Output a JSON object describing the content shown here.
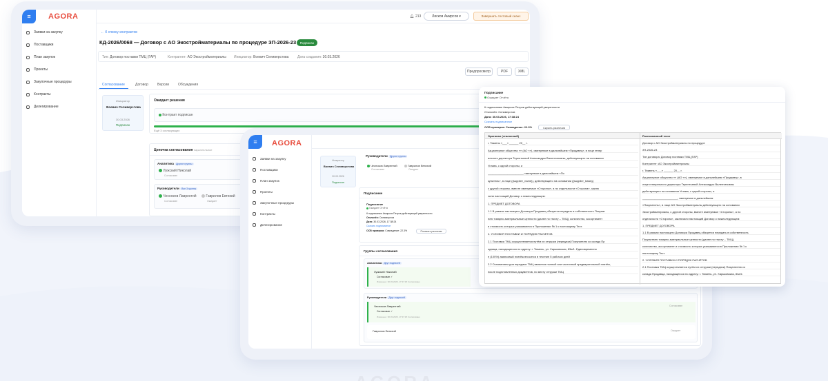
{
  "brand": "AGORA",
  "nav": [
    {
      "icon": "user-icon",
      "label": "Заявки на закупку"
    },
    {
      "icon": "building-icon",
      "label": "Поставщики"
    },
    {
      "icon": "calendar-icon",
      "label": "План закупок"
    },
    {
      "icon": "folder-icon",
      "label": "Проекты"
    },
    {
      "icon": "list-icon",
      "label": "Закупочные процедуры"
    },
    {
      "icon": "document-icon",
      "label": "Контракты"
    },
    {
      "icon": "stack-icon",
      "label": "Делегирование"
    }
  ],
  "header": {
    "counter": "213",
    "user": "Лисков Амирсов",
    "action": "Завершить тестовый сеанс"
  },
  "contract": {
    "back": "← К списку контрактов",
    "title": "КД-2026/0068 — Договор с АО Экостройматериалы по процедуре ЗП-2026-23",
    "status": "Подписан",
    "meta": [
      {
        "k": "Тип:",
        "v": "Договор поставки ТМЦ (ГАР)"
      },
      {
        "k": "Контрагент:",
        "v": "АО Экостройматериалы"
      },
      {
        "k": "Инициатор:",
        "v": "Воевич Селиверстова"
      },
      {
        "k": "Дата создания:",
        "v": "30.03.2026"
      }
    ],
    "buttons": [
      "Предпросмотр",
      "PDF",
      "XML"
    ],
    "tabs": [
      "Согласование",
      "Договор",
      "Версии",
      "Обсуждения"
    ]
  },
  "approval": {
    "initiator_label": "Инициатор",
    "initiator_name": "Воевич Селиверстова",
    "initiator_date": "30.03.2026",
    "initiator_status": "Подписан",
    "current_title": "Ожидает решения",
    "signer_label": "Контракт подписан",
    "progress_note": "Ещё 3 согласующих",
    "progress": 1.0,
    "groups_title": "Цепочка согласования",
    "groups_tag": "параллельное",
    "group1": "Аналитика",
    "group1_tag": "Другие группы",
    "group1_person": "Лужский Николай",
    "group1_state": "Согласован",
    "group2": "Руководители",
    "group2_tag": "Все 3 группы",
    "group2_person1": "Чесноков Лаврентий",
    "group2_person1_state": "Согласован",
    "group2_person2": "Гаврилов Евтихий",
    "group2_person2_state": "Ожидает"
  },
  "front": {
    "managers": "Руководители",
    "managers_tag": "Другие группы",
    "p1": "Чесноков Лаврентий",
    "p1_state": "Согласован",
    "p2": "Гаврилов Евтихий",
    "p2_state": "Ожидает",
    "signing_title": "Подписание",
    "sign_label": "Подписание",
    "sign_state": "Ожидает Отчёта",
    "sign_who": "К подписанию Амирсов Петров действующий уверенности",
    "sign_user_k": "Отклонён:",
    "sign_user_v": "Селиверстов",
    "sign_date_k": "Дата:",
    "sign_date_v": "30.03.2026, 17:38:24",
    "sign_link": "Скачать подписанное",
    "sign_check_k": "ОСВ проверка:",
    "sign_check_v": "Совпадение: 22.3%",
    "sign_check_btn": "Показать различия",
    "chain_title": "Группы согласования",
    "g1": "Аналитика",
    "g1_tag": "Друг подписей",
    "g1_person": "Лужский Николай",
    "g1_state": "Согласован ✓",
    "g1_date": "Изменено: 30.03.2026, 17:37:18 Согласовано",
    "g2": "Руководители",
    "g2_tag": "Друг подписей",
    "g2_person": "Чесноков Лаврентий",
    "g2_state": "Согласован ✓",
    "g2_date": "Изменено: 30.03.2026, 17:37:18 Согласовано",
    "g2_right": "Согласован",
    "g3_person": "Гаврилов Евтихий",
    "g3_right": "Ожидает"
  },
  "doc": {
    "label": "Подписание",
    "state": "Ожидает Отчёта",
    "who": "К подписанию Амирсов Петров действующий уверенности",
    "user": "Отклонён: Селиверстов",
    "date": "Дата: 30.03.2026, 17:38:24",
    "link": "Скачать подписанное",
    "check": "ОСВ проверка: Совпадение: 22.3%",
    "check_btn": "Скрыть различия",
    "col_left": "Оригинал (эталонный)",
    "col_right": "Распознанный текст",
    "left_lines": [
      "г. Тюмень «___» ______ 20__ г.",
      "Акционерное общество «» (АО «»), именуемое в дальнейшем «Продавец», в лице генер",
      "ального директора Терентьевой Александры Валентиновны, действующего на основании",
      "Устава, с одной стороны, и",
      "_______________________, именуемое в дальнейшем «По",
      "купатель», в лице {{supplier_name}}, действующего на основании {{supplier_basis}}",
      "с другой стороны, вместе именуемые «Стороны», а по отдельности «Сторона», заклю",
      "чили настоящий Договор о нижеследующем:",
      "1. ПРЕДМЕТ ДОГОВОРА",
      "1.1 В рамках настоящего Договора Продавец обязуется передать в собственность Покупат",
      "елю товарно-материальные ценности (далее по тексту – ТМЦ), количество, ассортимент",
      "и стоимость которых указываются в Приложении № 1 к настоящему Тест.",
      "2. УСЛОВИЯ ПОСТАВКИ И ПОРЯДОК РАСЧЁТОВ",
      "2.1 Поставка ТМЦ осуществляется путём их отгрузки (передачи) Покупателю со склада Пр",
      "одавца, находящегося по адресу: г. Тюмень, ул. Харьковская, 83а/1. Единовременно",
      "е (100%) авансовый платёж вносится в течение 5 рабочих дней",
      "2.2 Основанием для передачи ТМЦ является полный или частичный предварительный платёж,",
      "после подготовленных документов, по месту отгрузки ТМЦ"
    ],
    "right_lines": [
      "Договор с АО Экостройматериалы по процедуре",
      "ЗП-2026-23",
      "Тип договора: Договор поставки ТМЦ (ГАР)",
      "Контрагент: АО Экостройматериалы",
      "г. Тюмень «___» ______ 20__ г.",
      "Акционерное общество «» (АО «»), именуемое в дальнейшем «Продавец», в",
      "лице генерального директора Терентьевой Александры Валентиновны",
      "действующего на основании Устава, с одной стороны, и",
      "_______________________, именуемое в дальнейшем",
      "«Покупатель», в лице АО Экостройматериалы действующего на основании",
      "Экостройматериалы, с другой стороны, вместе именуемые «Стороны», а по",
      "отдельности «Сторона», заключили настоящий Договор о нижеследующем:",
      "1. ПРЕДМЕТ ДОГОВОРА",
      "1.1 В рамках настоящего Договора Продавец обязуется передать в собственность",
      "Покупателю товарно-материальные ценности (далее по тексту – ТМЦ),",
      "количество, ассортимент и стоимость которых указываются в Приложении № 1 к",
      "настоящему Тест.",
      "2. УСЛОВИЯ ПОСТАВКИ И ПОРЯДОК РАСЧЁТОВ",
      "2.1 Поставка ТМЦ осуществляется путём их отгрузки (передачи) Покупателю со",
      "склада Продавца, находящегося по адресу: г. Тюмень, ул. Харьковская, 83а/1"
    ]
  },
  "colors": {
    "accent": "#2f7ef0",
    "brand": "#e84c3d",
    "success": "#2eb14b"
  }
}
